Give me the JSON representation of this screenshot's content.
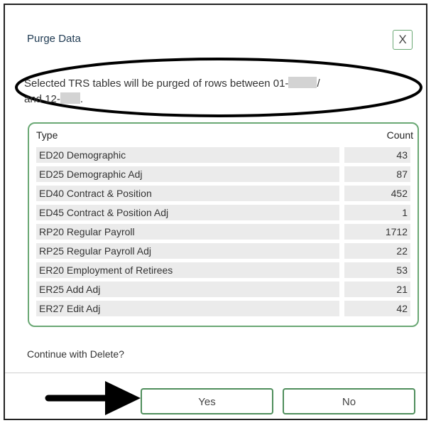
{
  "dialog": {
    "title": "Purge Data",
    "close_label": "X",
    "message_line1": "Selected TRS tables will be purged of rows between 01-",
    "message_line1_end": "/",
    "message_line2": "and 12-",
    "message_line2_end": "."
  },
  "table": {
    "headers": {
      "type": "Type",
      "count": "Count"
    },
    "rows": [
      {
        "type": "ED20 Demographic",
        "count": "43"
      },
      {
        "type": "ED25 Demographic Adj",
        "count": "87"
      },
      {
        "type": "ED40 Contract & Position",
        "count": "452"
      },
      {
        "type": "ED45 Contract & Position Adj",
        "count": "1"
      },
      {
        "type": "RP20 Regular Payroll",
        "count": "1712"
      },
      {
        "type": "RP25 Regular Payroll Adj",
        "count": "22"
      },
      {
        "type": "ER20 Employment of Retirees",
        "count": "53"
      },
      {
        "type": "ER25 Add Adj",
        "count": "21"
      },
      {
        "type": "ER27 Edit Adj",
        "count": "42"
      }
    ]
  },
  "footer": {
    "prompt": "Continue with Delete?",
    "yes_label": "Yes",
    "no_label": "No"
  },
  "colors": {
    "accent_green": "#4f8e5c",
    "row_bg": "#ebebeb",
    "annotation": "#000000"
  },
  "icons": [
    "close-icon",
    "arrow-right-icon"
  ]
}
